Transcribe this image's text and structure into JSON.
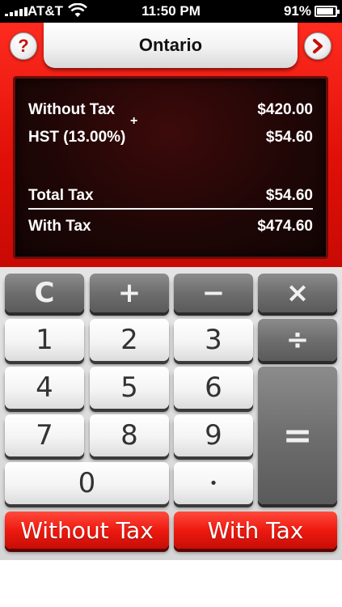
{
  "status_bar": {
    "carrier": "AT&T",
    "time": "11:50 PM",
    "battery": "91%",
    "battery_level": 0.91
  },
  "header": {
    "title": "Ontario",
    "help_label": "?",
    "next_label": "›"
  },
  "display": {
    "without_tax_label": "Without Tax",
    "without_tax_value": "$420.00",
    "plus_sign": "+",
    "hst_label": "HST (13.00%)",
    "hst_value": "$54.60",
    "total_tax_label": "Total Tax",
    "total_tax_value": "$54.60",
    "with_tax_label": "With Tax",
    "with_tax_value": "$474.60"
  },
  "keypad": {
    "clear": "C",
    "plus": "+",
    "minus": "−",
    "multiply": "×",
    "divide": "÷",
    "equals": "=",
    "seven": "7",
    "eight": "8",
    "nine": "9",
    "four": "4",
    "five": "5",
    "six": "6",
    "one": "1",
    "two": "2",
    "three": "3",
    "zero": "0",
    "dot": "•",
    "without_tax": "Without Tax",
    "with_tax": "With Tax"
  },
  "colors": {
    "accent_red": "#e01008",
    "display_bg": "#1e0606"
  }
}
